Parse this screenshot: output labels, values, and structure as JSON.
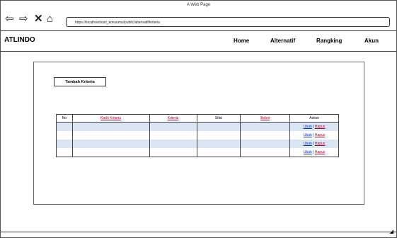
{
  "window": {
    "title": "A Web Page"
  },
  "browser": {
    "back_icon": "back-arrow-icon",
    "forward_icon": "forward-arrow-icon",
    "stop_icon": "close-icon",
    "home_icon": "home-icon",
    "url": "https://localhost/sisti_konsumsi/public/alternatif/kriteria"
  },
  "navbar": {
    "brand": "ATLINDO",
    "items": [
      "Home",
      "Alternatif",
      "Rangking",
      "Akun"
    ]
  },
  "page": {
    "add_button": "Tambah Kriteria",
    "table": {
      "headers": [
        "No",
        "Kode Kriteria",
        "Kriteria",
        "Sifat",
        "Bobot",
        "Action"
      ],
      "rows": [
        {
          "no": "",
          "kode": "",
          "kriteria": "",
          "sifat": "",
          "bobot": "",
          "action_edit": "Ubah",
          "action_sep": " | ",
          "action_delete": "Hapus"
        },
        {
          "no": "",
          "kode": "",
          "kriteria": "",
          "sifat": "",
          "bobot": "",
          "action_edit": "Ubah",
          "action_sep": " | ",
          "action_delete": "Hapus"
        },
        {
          "no": "",
          "kode": "",
          "kriteria": "",
          "sifat": "",
          "bobot": "",
          "action_edit": "Ubah",
          "action_sep": " | ",
          "action_delete": "Hapus"
        },
        {
          "no": "",
          "kode": "",
          "kriteria": "",
          "sifat": "",
          "bobot": "",
          "action_edit": "Ubah",
          "action_sep": " | ",
          "action_delete": "Hapus"
        }
      ]
    }
  },
  "colors": {
    "row_band": "#dbe6f5",
    "link": "#0033cc",
    "accent_red": "#b0002a"
  }
}
